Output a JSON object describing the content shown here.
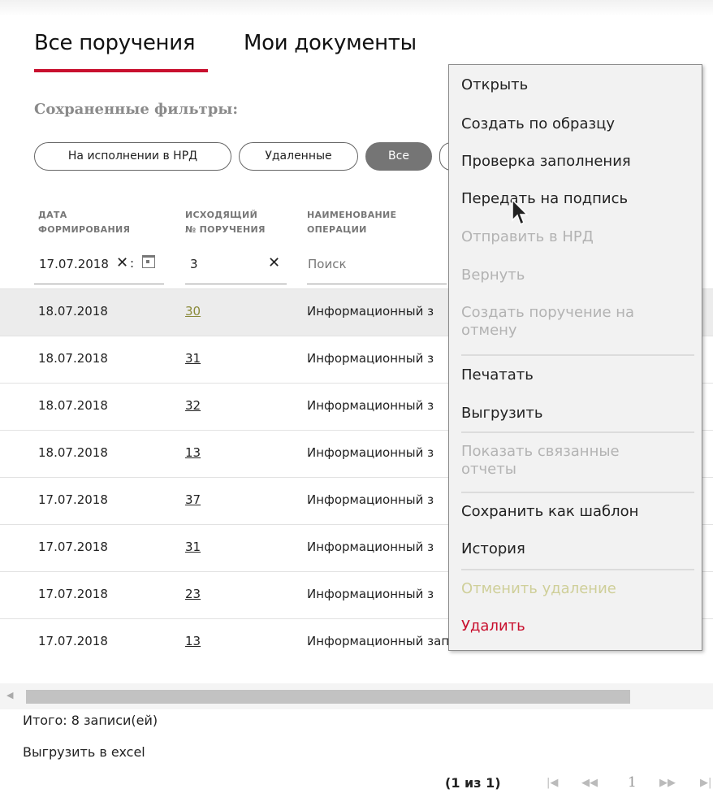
{
  "tabs": {
    "all_label": "Все поручения",
    "docs_label": "Мои документы"
  },
  "filters": {
    "label": "Сохраненные фильтры:",
    "chips": [
      "На исполнении в НРД",
      "Удаленные",
      "Все"
    ]
  },
  "table": {
    "headers": {
      "date": [
        "ДАТА",
        "ФОРМИРОВАНИЯ"
      ],
      "number": [
        "ИСХОДЯЩИЙ",
        "№ ПОРУЧЕНИЯ"
      ],
      "operation": [
        "НАИМЕНОВАНИЕ",
        "ОПЕРАЦИИ"
      ]
    },
    "filter_values": {
      "date": "17.07.2018",
      "date_sep": ":",
      "number": "3",
      "operation_placeholder": "Поиск",
      "clear_glyph": "✕"
    },
    "rows": [
      {
        "date": "18.07.2018",
        "number": "30",
        "operation": "Информационный з"
      },
      {
        "date": "18.07.2018",
        "number": "31",
        "operation": "Информационный з"
      },
      {
        "date": "18.07.2018",
        "number": "32",
        "operation": "Информационный з"
      },
      {
        "date": "18.07.2018",
        "number": "13",
        "operation": "Информационный з"
      },
      {
        "date": "17.07.2018",
        "number": "37",
        "operation": "Информационный з"
      },
      {
        "date": "17.07.2018",
        "number": "31",
        "operation": "Информационный з"
      },
      {
        "date": "17.07.2018",
        "number": "23",
        "operation": "Информационный з"
      },
      {
        "date": "17.07.2018",
        "number": "13",
        "operation": "Информационный запрос по состоянию анкеты"
      }
    ],
    "highlighted_row": 0
  },
  "footer": {
    "total": "Итого: 8 записи(ей)",
    "export": "Выгрузить в excel"
  },
  "pager": {
    "info": "(1 из 1)",
    "current": "1",
    "first": "|◀",
    "prev": "◀◀",
    "next": "▶▶",
    "last": "▶|"
  },
  "context_menu": {
    "items": [
      {
        "label": "Открыть",
        "state": "enabled"
      },
      {
        "label": "Создать по образцу",
        "state": "enabled"
      },
      {
        "label": "Проверка заполнения",
        "state": "enabled"
      },
      {
        "label": "Передать на подпись",
        "state": "enabled"
      },
      {
        "label": "Отправить в НРД",
        "state": "disabled"
      },
      {
        "label": "Вернуть",
        "state": "disabled"
      },
      {
        "label": "Создать поручение на",
        "label2": "отмену",
        "state": "disabled"
      },
      {
        "label": "Печатать",
        "state": "enabled"
      },
      {
        "label": "Выгрузить",
        "state": "enabled"
      },
      {
        "label": "Показать связанные",
        "label2": "отчеты",
        "state": "disabled"
      },
      {
        "label": "Сохранить как шаблон",
        "state": "enabled"
      },
      {
        "label": "История",
        "state": "enabled"
      },
      {
        "label": "Отменить удаление",
        "state": "disabled"
      },
      {
        "label": "Удалить",
        "state": "danger"
      }
    ]
  },
  "colors": {
    "accent": "#c8102e",
    "chip_active": "#757575",
    "highlight_row": "#ececec",
    "menu_bg": "#f2f2f2"
  }
}
